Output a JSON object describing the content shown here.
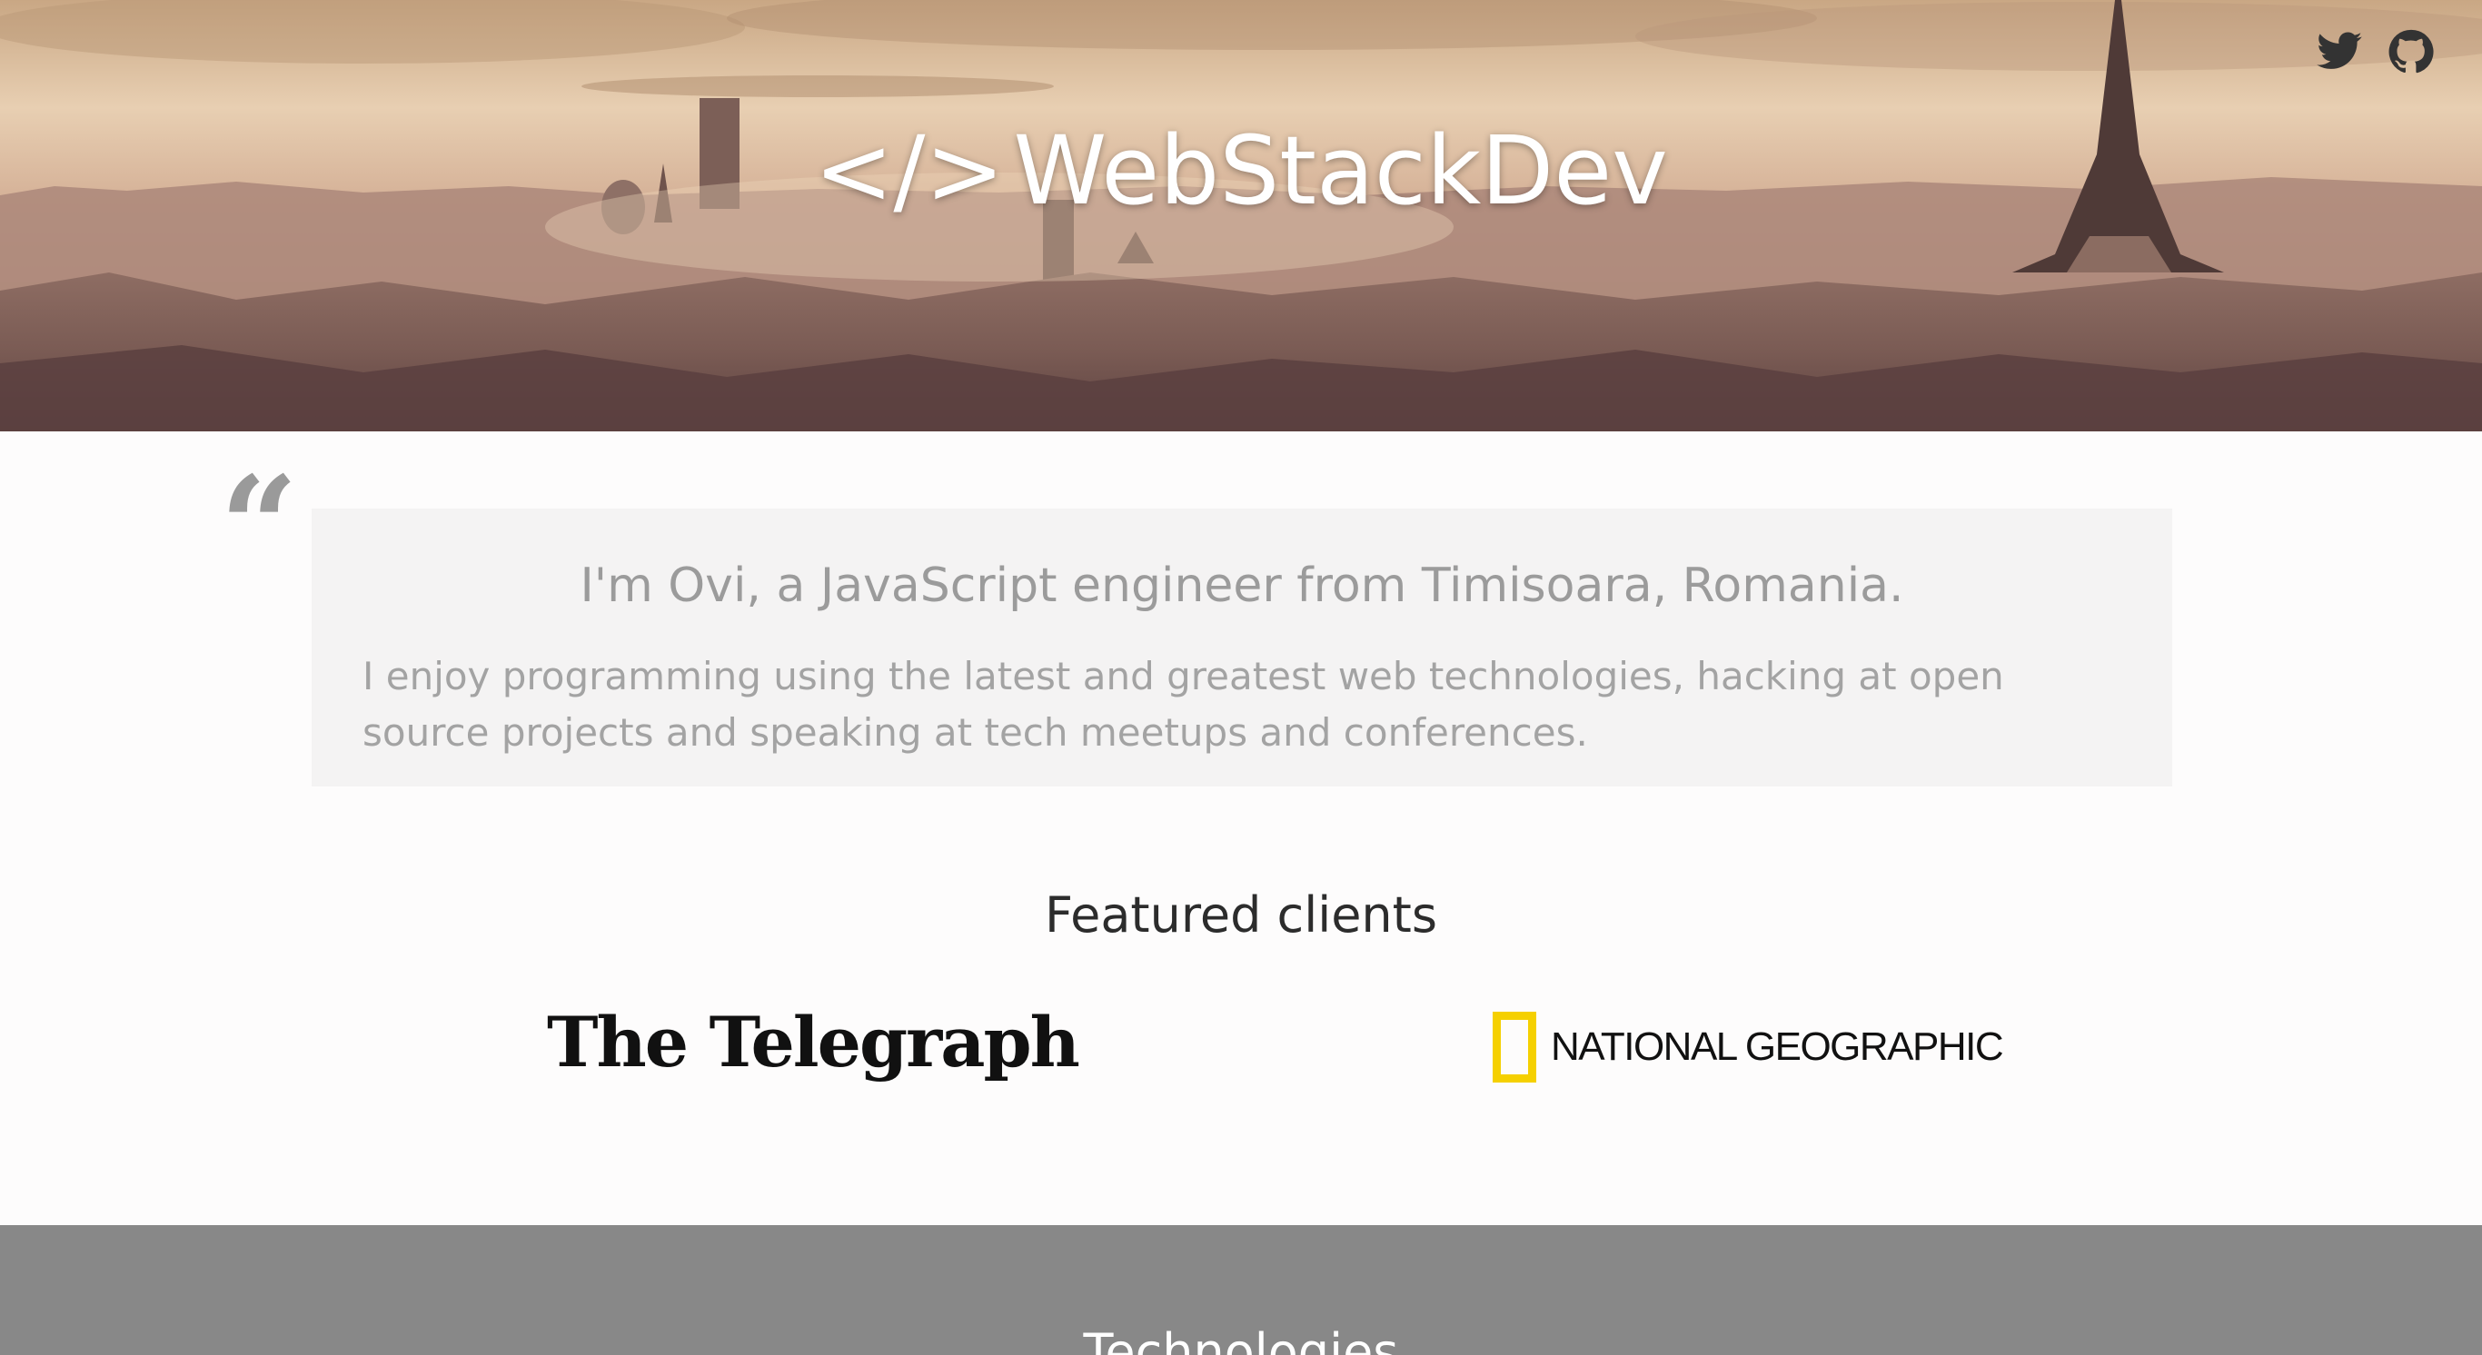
{
  "brand": {
    "code_mark": "</>",
    "name": "WebStackDev"
  },
  "social": [
    {
      "name": "twitter-icon",
      "label": "Twitter"
    },
    {
      "name": "github-icon",
      "label": "GitHub"
    }
  ],
  "intro": {
    "headline": "I'm Ovi, a JavaScript engineer from Timisoara, Romania.",
    "body": "I enjoy programming using the latest and greatest web technologies, hacking at open source projects and speaking at tech meetups and conferences."
  },
  "clients": {
    "title": "Featured clients",
    "logos": [
      {
        "text": "The Telegraph"
      },
      {
        "text": "NATIONAL GEOGRAPHIC"
      }
    ]
  },
  "technologies": {
    "title": "Technologies"
  },
  "colors": {
    "tech_band": "#888888",
    "natgeo_yellow": "#f5d000",
    "quote_box": "#f4f3f3"
  }
}
